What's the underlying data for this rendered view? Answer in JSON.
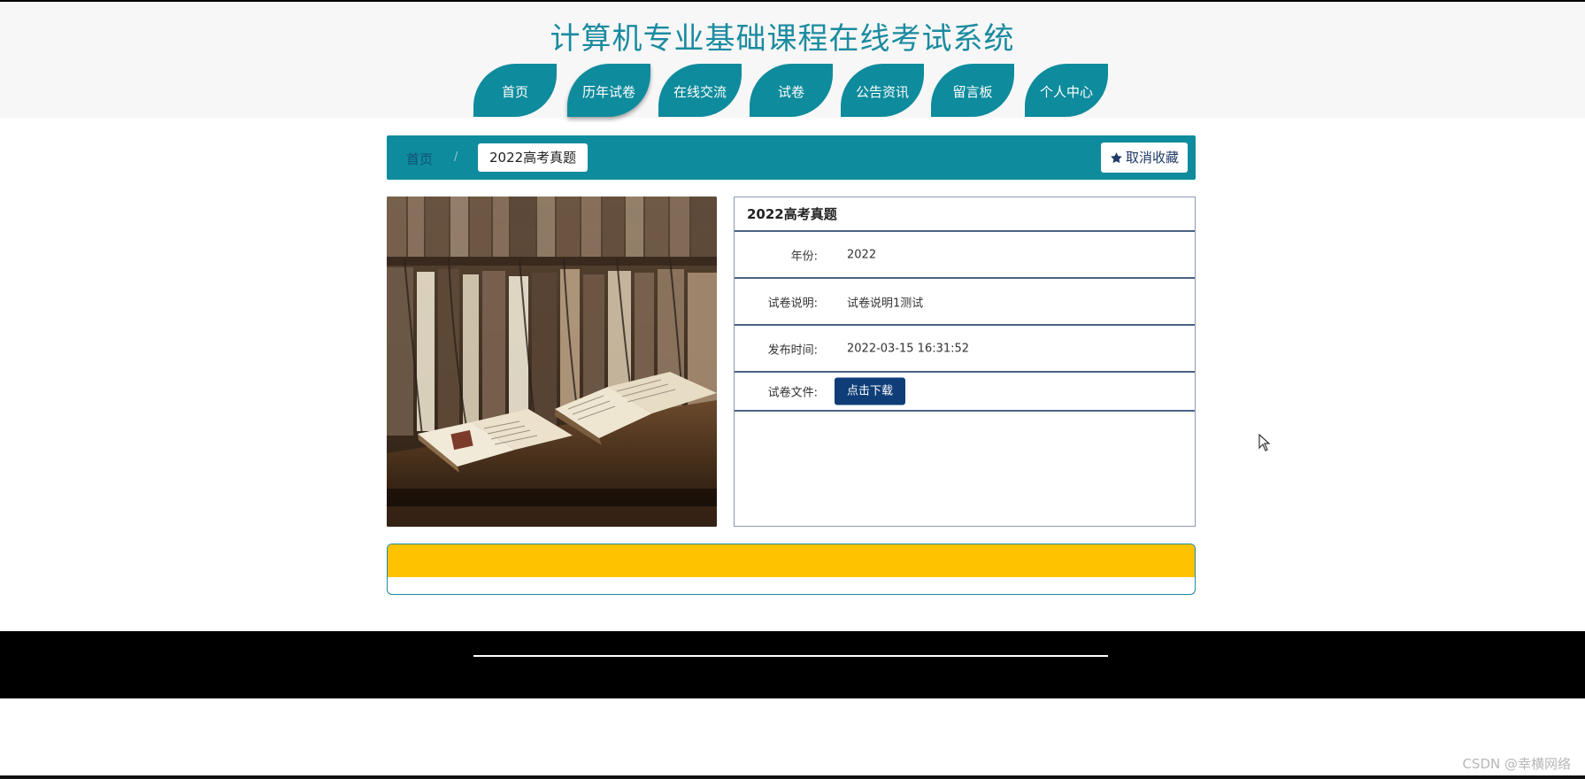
{
  "header": {
    "site_title": "计算机专业基础课程在线考试系统",
    "nav": [
      {
        "label": "首页",
        "active": false
      },
      {
        "label": "历年试卷",
        "active": true
      },
      {
        "label": "在线交流",
        "active": false
      },
      {
        "label": "试卷",
        "active": false
      },
      {
        "label": "公告资讯",
        "active": false
      },
      {
        "label": "留言板",
        "active": false
      },
      {
        "label": "个人中心",
        "active": false
      }
    ]
  },
  "breadcrumb": {
    "home": "首页",
    "separator": "/",
    "current": "2022高考真题",
    "favorite_button": "取消收藏"
  },
  "detail": {
    "title": "2022高考真题",
    "rows": [
      {
        "label": "年份:",
        "value": "2022"
      },
      {
        "label": "试卷说明:",
        "value": "试卷说明1测试"
      },
      {
        "label": "发布时间:",
        "value": "2022-03-15 16:31:52"
      }
    ],
    "file_label": "试卷文件:",
    "download_button": "点击下载"
  },
  "watermark": "CSDN @幸横网络",
  "colors": {
    "primary_teal": "#0e8b9c",
    "download_navy": "#0f3d78",
    "yellow": "#ffc200",
    "footer": "#000000"
  },
  "icons": {
    "favorite": "star-icon",
    "cursor": "mouse-pointer-icon"
  }
}
